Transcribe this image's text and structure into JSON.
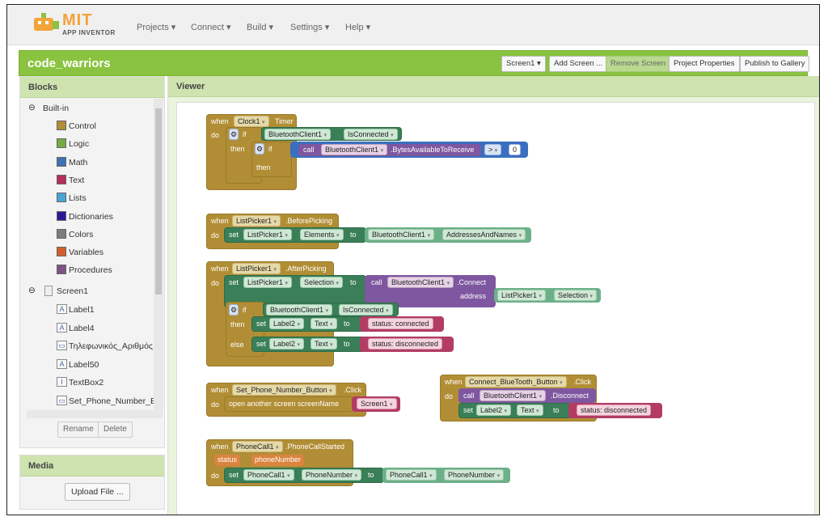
{
  "app": {
    "brand": "MIT",
    "subtitle": "APP INVENTOR"
  },
  "nav": [
    "Projects ▾",
    "Connect ▾",
    "Build ▾",
    "Settings ▾",
    "Help ▾"
  ],
  "project": {
    "name": "code_warriors",
    "screen": "Screen1 ▾",
    "add_screen": "Add Screen ...",
    "remove_screen": "Remove Screen",
    "properties": "Project Properties",
    "publish": "Publish to Gallery"
  },
  "panels": {
    "blocks": "Blocks",
    "viewer": "Viewer",
    "media": "Media"
  },
  "builtin": {
    "label": "Built-in",
    "items": [
      {
        "name": "Control",
        "color": "#b18e35"
      },
      {
        "name": "Logic",
        "color": "#77ab41"
      },
      {
        "name": "Math",
        "color": "#3f71b5"
      },
      {
        "name": "Text",
        "color": "#b32d5e"
      },
      {
        "name": "Lists",
        "color": "#49a6d4"
      },
      {
        "name": "Dictionaries",
        "color": "#2d1799"
      },
      {
        "name": "Colors",
        "color": "#7d7d7d"
      },
      {
        "name": "Variables",
        "color": "#d05f2d"
      },
      {
        "name": "Procedures",
        "color": "#7c5385"
      }
    ]
  },
  "screen": {
    "label": "Screen1",
    "components": [
      "Label1",
      "Label4",
      "Τηλεφωνικός_Αριθμός",
      "Label50",
      "TextBox2",
      "Set_Phone_Number_Bu"
    ]
  },
  "tree_buttons": {
    "rename": "Rename",
    "delete": "Delete"
  },
  "upload": "Upload File ...",
  "b1": {
    "when": "when",
    "comp": "Clock1",
    "event": "Timer",
    "do": "do",
    "if": "if",
    "bt": "BluetoothClient1",
    "prop": "IsConnected",
    "then": "then",
    "if2": "if",
    "call": "call",
    "method": ".BytesAvailableToReceive",
    "op": ">",
    "num": "0",
    "then2": "then"
  },
  "b2": {
    "when": "when",
    "comp": "ListPicker1",
    "event": ".BeforePicking",
    "do": "do",
    "set": "set",
    "lp": "ListPicker1",
    "prop": "Elements",
    "to": "to",
    "bt": "BluetoothClient1",
    "val": "AddressesAndNames"
  },
  "b3": {
    "when": "when",
    "comp": "ListPicker1",
    "event": ".AfterPicking",
    "do": "do",
    "set": "set",
    "lp": "ListPicker1",
    "prop": "Selection",
    "to": "to",
    "call": "call",
    "bt": "BluetoothClient1",
    "method": ".Connect",
    "address": "address",
    "lp2": "ListPicker1",
    "prop2": "Selection",
    "if": "if",
    "bt2": "BluetoothClient1",
    "isc": "IsConnected",
    "then": "then",
    "set2": "set",
    "lbl": "Label2",
    "text": "Text",
    "to2": "to",
    "s1": "status: connected",
    "else": "else",
    "set3": "set",
    "lbl2": "Label2",
    "text2": "Text",
    "to3": "to",
    "s2": "status: disconnected"
  },
  "b4": {
    "when": "when",
    "comp": "Set_Phone_Number_Button",
    "event": ".Click",
    "do": "do",
    "open": "open another screen  screenName",
    "scr": "Screen1"
  },
  "b5": {
    "when": "when",
    "comp": "Connect_BlueTooth_Button",
    "event": ".Click",
    "do": "do",
    "call": "call",
    "bt": "BluetoothClient1",
    "method": ".Disconnect",
    "set": "set",
    "lbl": "Label2",
    "text": "Text",
    "to": "to",
    "s": "status: disconnected"
  },
  "b6": {
    "when": "when",
    "comp": "PhoneCall1",
    "event": ".PhoneCallStarted",
    "status": "status",
    "phone": "phoneNumber",
    "do": "do",
    "set": "set",
    "pc": "PhoneCall1",
    "prop": "PhoneNumber",
    "to": "to",
    "pc2": "PhoneCall1",
    "prop2": "PhoneNumber"
  }
}
